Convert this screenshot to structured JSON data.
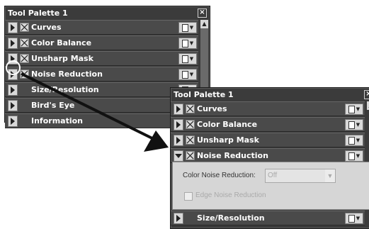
{
  "palette1": {
    "title": "Tool Palette 1",
    "close": "×",
    "rows": [
      {
        "label": "Curves"
      },
      {
        "label": "Color Balance"
      },
      {
        "label": "Unsharp Mask"
      },
      {
        "label": "Noise Reduction"
      },
      {
        "label": "Size/Resolution"
      },
      {
        "label": "Bird's Eye"
      },
      {
        "label": "Information"
      }
    ]
  },
  "palette2": {
    "title": "Tool Palette 1",
    "close": "×",
    "rows": [
      {
        "label": "Curves"
      },
      {
        "label": "Color Balance"
      },
      {
        "label": "Unsharp Mask"
      },
      {
        "label": "Noise Reduction"
      },
      {
        "label": "Size/Resolution"
      }
    ],
    "settings": {
      "color_noise_label": "Color Noise Reduction:",
      "color_noise_value": "Off",
      "edge_noise_label": "Edge Noise Reduction"
    }
  },
  "colors": {
    "panel_bg": "#3b3b3b",
    "row_bg": "#4a4a4a",
    "settings_bg": "#d6d6d6"
  }
}
